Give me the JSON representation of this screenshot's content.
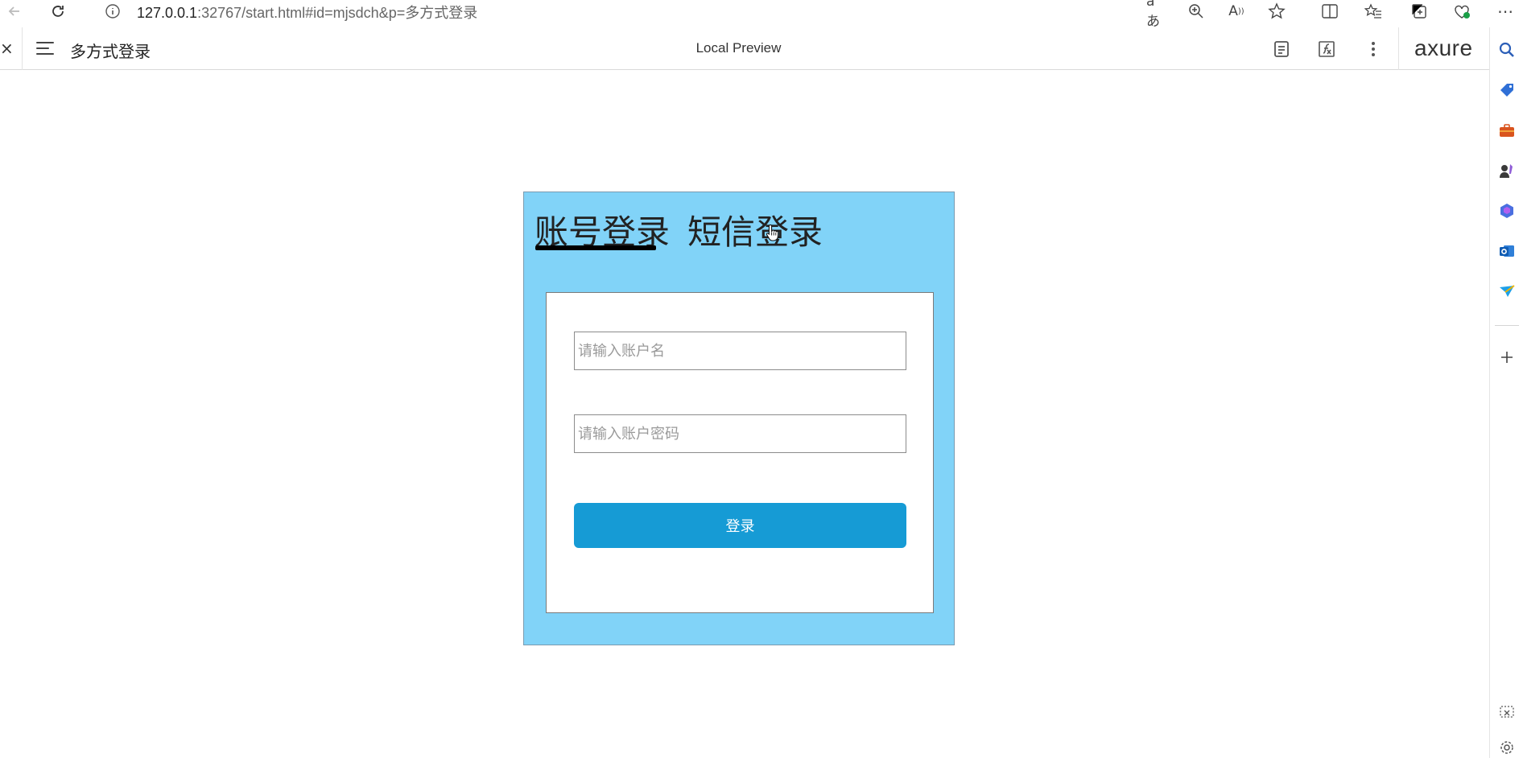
{
  "browser": {
    "url_host": "127.0.0.1",
    "url_rest": ":32767/start.html#id=mjsdch&p=多方式登录"
  },
  "axure_toolbar": {
    "close_label": "×",
    "page_name": "多方式登录",
    "center_title": "Local Preview",
    "logo_text": "axure"
  },
  "login": {
    "tab_account": "账号登录",
    "tab_sms": "短信登录",
    "account_placeholder": "请输入账户名",
    "password_placeholder": "请输入账户密码",
    "submit_label": "登录"
  },
  "colors": {
    "card_bg": "#81d3f8",
    "button_bg": "#169bd5"
  }
}
